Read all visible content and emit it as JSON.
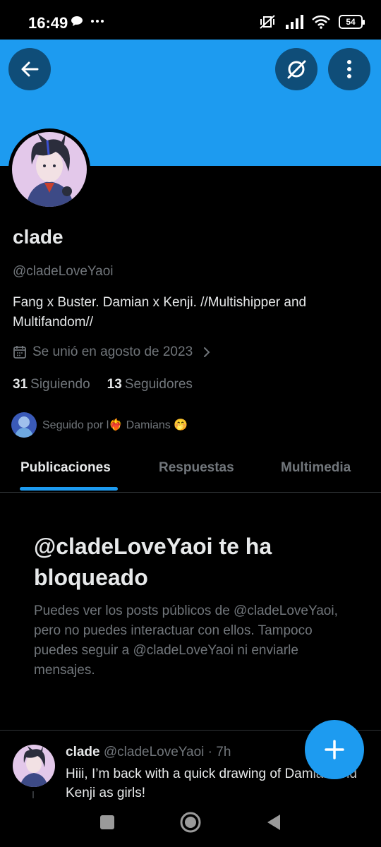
{
  "colors": {
    "banner": "#1d9bf0",
    "accent": "#1d9bf0",
    "button_bg": "#0f4d78",
    "muted": "#71767b",
    "text": "#e7e9ea"
  },
  "status_bar": {
    "time": "16:49",
    "left_icons": [
      "chat-bubble-icon",
      "more-dots-icon"
    ],
    "right_icons": [
      "mute-vibrate-icon",
      "signal-icon",
      "wifi-icon",
      "battery-icon"
    ],
    "battery_level": "54"
  },
  "header_buttons": {
    "back": "back-arrow-icon",
    "grok": "grok-icon",
    "more": "more-vertical-icon"
  },
  "profile": {
    "name": "clade",
    "handle": "@cladeLoveYaoi",
    "bio": "Fang x Buster. Damian x Kenji. //Multishipper and Multifandom//",
    "joined": "Se unió en agosto de 2023",
    "following_count": "31",
    "following_label": "Siguiendo",
    "followers_count": "13",
    "followers_label": "Seguidores",
    "followed_by": "Seguido por l❤️‍🔥 Damians 🤭"
  },
  "tabs": [
    {
      "label": "Publicaciones",
      "active": true
    },
    {
      "label": "Respuestas",
      "active": false
    },
    {
      "label": "Multimedia",
      "active": false
    }
  ],
  "blocked": {
    "title": "@cladeLoveYaoi te ha bloqueado",
    "description": "Puedes ver los posts públicos de @cladeLoveYaoi, pero no puedes interactuar con ellos. Tampoco puedes seguir a @cladeLoveYaoi ni enviarle mensajes."
  },
  "post": {
    "name": "clade",
    "handle_time": "@cladeLoveYaoi · 7h",
    "text": "Hiii, I’m back with a quick drawing of Damian and Kenji as girls!"
  },
  "fab": {
    "icon": "plus-icon"
  },
  "nav_bar": [
    "recents-square-icon",
    "home-circle-icon",
    "back-triangle-icon"
  ]
}
